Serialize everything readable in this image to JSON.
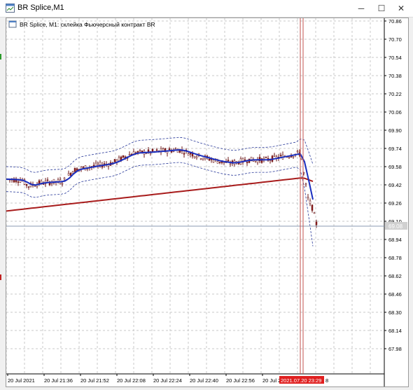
{
  "window": {
    "title": "BR Splice,M1",
    "minimize_glyph": "─",
    "maximize_glyph": "☐",
    "close_glyph": "✕"
  },
  "chart": {
    "header": "BR Splice, M1:  склейка Фьючерсный контракт BR",
    "current_price_label": "69.08",
    "crosshair_time_label": "2021.07.20 23:29",
    "y_axis_labels": [
      "70.86",
      "70.70",
      "70.54",
      "70.38",
      "70.22",
      "70.06",
      "69.90",
      "69.74",
      "69.58",
      "69.42",
      "69.26",
      "69.10",
      "68.94",
      "68.78",
      "68.62",
      "68.46",
      "68.30",
      "68.14",
      "67.98"
    ],
    "x_axis_labels": [
      "20 Jul 2021",
      "20 Jul 21:36",
      "20 Jul 21:52",
      "20 Jul 22:08",
      "20 Jul 22:24",
      "20 Jul 22:40",
      "20 Jul 22:56",
      "20 Jul 2"
    ],
    "x_axis_tail": "8",
    "colors": {
      "background": "#ffffff",
      "grid": "#c8c8c8",
      "candle": "#8b1a1a",
      "ma_fast": "#1a2fbf",
      "ma_slow": "#a81c1c",
      "bands": "#2a3a9a",
      "crosshair": "#c0504d",
      "time_label_bg": "#e02020",
      "price_label_bg": "#d0d0d0"
    }
  }
}
